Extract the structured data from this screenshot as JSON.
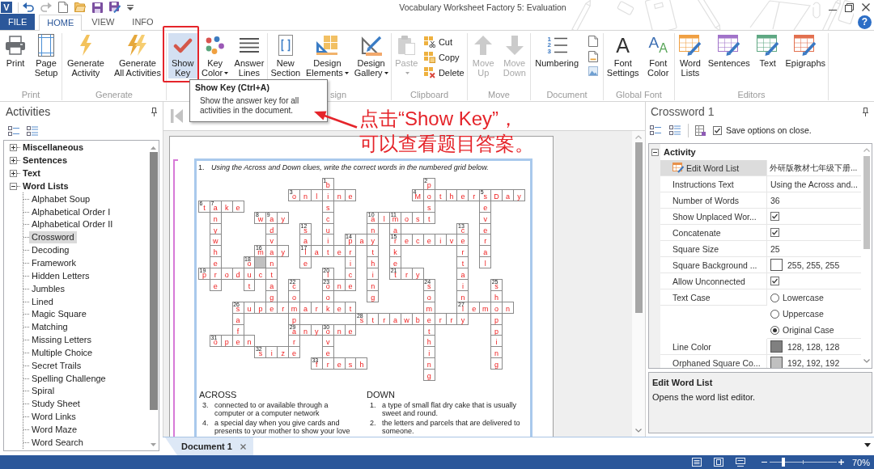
{
  "window": {
    "logo": "V",
    "title": "Vocabulary Worksheet Factory 5: Evaluation",
    "help": "?"
  },
  "ribbon": {
    "tabs": [
      {
        "label": "FILE",
        "kind": "backstage",
        "selected": false
      },
      {
        "label": "HOME",
        "kind": "tab",
        "selected": true
      },
      {
        "label": "VIEW",
        "kind": "tab",
        "selected": false
      },
      {
        "label": "INFO",
        "kind": "tab",
        "selected": false
      }
    ],
    "groups": [
      {
        "label": "Print",
        "buttons": [
          {
            "kind": "large",
            "label": "Print",
            "on": false,
            "disabled": false,
            "dropdown": false
          },
          {
            "kind": "large",
            "label": "Page Setup",
            "on": false,
            "disabled": false,
            "dropdown": false
          }
        ]
      },
      {
        "label": "Generate",
        "buttons": [
          {
            "kind": "large",
            "label": "Generate Activity",
            "on": false,
            "disabled": false,
            "dropdown": false
          },
          {
            "kind": "large",
            "label": "Generate All Activities",
            "on": false,
            "disabled": false,
            "dropdown": false
          }
        ]
      },
      {
        "buttons": [
          {
            "kind": "large",
            "label": "Show Key",
            "on": true,
            "disabled": false,
            "dropdown": false
          },
          {
            "kind": "large",
            "label": "Key Color",
            "on": false,
            "disabled": false,
            "dropdown": true
          },
          {
            "kind": "large",
            "label": "Answer Lines",
            "on": false,
            "disabled": false,
            "dropdown": false
          }
        ]
      },
      {
        "label": "sign",
        "buttons": [
          {
            "kind": "large",
            "label": "New Section",
            "on": false,
            "disabled": false,
            "dropdown": false
          },
          {
            "kind": "large",
            "label": "Design Elements",
            "on": false,
            "disabled": false,
            "dropdown": true
          },
          {
            "kind": "large",
            "label": "Design Gallery",
            "on": false,
            "disabled": false,
            "dropdown": true
          }
        ]
      },
      {
        "label": "Clipboard",
        "buttons": [
          {
            "kind": "large",
            "label": "Paste",
            "on": false,
            "disabled": true,
            "dropdown": true
          },
          {
            "kind": "small",
            "label": "Cut",
            "on": false,
            "disabled": false,
            "dropdown": false
          },
          {
            "kind": "small",
            "label": "Copy",
            "on": false,
            "disabled": false,
            "dropdown": false
          },
          {
            "kind": "small",
            "label": "Delete",
            "on": false,
            "disabled": false,
            "dropdown": false
          }
        ]
      },
      {
        "label": "Move",
        "buttons": [
          {
            "kind": "large",
            "label": "Move Up",
            "on": false,
            "disabled": true,
            "dropdown": false
          },
          {
            "kind": "large",
            "label": "Move Down",
            "on": false,
            "disabled": true,
            "dropdown": false
          }
        ]
      },
      {
        "label": "Document",
        "buttons": [
          {
            "kind": "large",
            "label": "Numbering",
            "glyph": "123",
            "on": false,
            "disabled": false,
            "dropdown": false
          },
          {
            "kind": "icon",
            "on": false,
            "disabled": false,
            "dropdown": false
          },
          {
            "kind": "icon",
            "on": false,
            "disabled": false,
            "dropdown": false
          },
          {
            "kind": "icon",
            "on": false,
            "disabled": false,
            "dropdown": false
          }
        ]
      },
      {
        "label": "Global Font",
        "buttons": [
          {
            "kind": "large",
            "label": "Font Settings",
            "glyph": "A",
            "on": false,
            "disabled": false,
            "dropdown": false
          },
          {
            "kind": "large",
            "label": "Font Color",
            "glyph": "AA",
            "on": false,
            "disabled": false,
            "dropdown": false
          }
        ]
      },
      {
        "label": "Editors",
        "buttons": [
          {
            "kind": "large",
            "label": "Word Lists",
            "on": false,
            "disabled": false,
            "dropdown": false
          },
          {
            "kind": "large",
            "label": "Sentences",
            "on": false,
            "disabled": false,
            "dropdown": false
          },
          {
            "kind": "large",
            "label": "Text",
            "on": false,
            "disabled": false,
            "dropdown": false
          },
          {
            "kind": "large",
            "label": "Epigraphs",
            "on": false,
            "disabled": false,
            "dropdown": false
          }
        ]
      }
    ]
  },
  "tooltip": {
    "title": "Show Key (Ctrl+A)",
    "text": "Show the answer key for all activities in the document."
  },
  "annotation": {
    "lines": [
      "点击“Show Key”，",
      "可以查看题目答案。"
    ]
  },
  "activities": {
    "title": "Activities",
    "tree": [
      {
        "label": "Miscellaneous",
        "expanded": false,
        "selected": false
      },
      {
        "label": "Sentences",
        "expanded": false,
        "selected": false
      },
      {
        "label": "Text",
        "expanded": false,
        "selected": false
      },
      {
        "label": "Word Lists",
        "expanded": true,
        "selected": false,
        "children": [
          {
            "label": "Alphabet Soup",
            "selected": false
          },
          {
            "label": "Alphabetical Order I",
            "selected": false
          },
          {
            "label": "Alphabetical Order II",
            "selected": false
          },
          {
            "label": "Crossword",
            "selected": true
          },
          {
            "label": "Decoding",
            "selected": false
          },
          {
            "label": "Framework",
            "selected": false
          },
          {
            "label": "Hidden Letters",
            "selected": false
          },
          {
            "label": "Jumbles",
            "selected": false
          },
          {
            "label": "Lined",
            "selected": false
          },
          {
            "label": "Magic Square",
            "selected": false
          },
          {
            "label": "Matching",
            "selected": false
          },
          {
            "label": "Missing Letters",
            "selected": false
          },
          {
            "label": "Multiple Choice",
            "selected": false
          },
          {
            "label": "Secret Trails",
            "selected": false
          },
          {
            "label": "Spelling Challenge",
            "selected": false
          },
          {
            "label": "Spiral",
            "selected": false
          },
          {
            "label": "Study Sheet",
            "selected": false
          },
          {
            "label": "Word Links",
            "selected": false
          },
          {
            "label": "Word Maze",
            "selected": false
          },
          {
            "label": "Word Search",
            "selected": false
          }
        ]
      }
    ]
  },
  "document": {
    "activity": {
      "number": "1.",
      "instructions": "Using the Across and Down clues, write the correct words in the numbered grid below.",
      "squares": [
        [
          {
            "letter": "b",
            "number": "1"
          },
          {
            "letter": "p",
            "number": "2"
          }
        ],
        [
          {
            "letter": "o",
            "number": "3"
          },
          {
            "letter": "n"
          },
          {
            "letter": "l"
          },
          {
            "letter": "i"
          },
          {
            "letter": "n"
          },
          {
            "letter": "e"
          },
          {
            "letter": "M",
            "number": "4"
          },
          {
            "letter": "o"
          },
          {
            "letter": "t"
          },
          {
            "letter": "h"
          },
          {
            "letter": "e"
          },
          {
            "letter": "r"
          },
          {
            "letter": "s",
            "number": "5"
          },
          {
            "letter": "D"
          },
          {
            "letter": "a"
          },
          {
            "letter": "y"
          }
        ],
        [
          {
            "letter": "t",
            "number": "6"
          },
          {
            "letter": "a",
            "number": "7"
          },
          {
            "letter": "k"
          },
          {
            "letter": "e"
          },
          {
            "letter": "s"
          },
          {
            "letter": "s"
          },
          {
            "letter": "e"
          }
        ],
        [
          {
            "letter": "n"
          },
          {
            "letter": "w",
            "number": "8"
          },
          {
            "letter": "a",
            "number": "9"
          },
          {
            "letter": "y"
          },
          {
            "letter": "c"
          },
          {
            "letter": "a",
            "number": "10"
          },
          {
            "letter": "l"
          },
          {
            "letter": "m",
            "number": "11"
          },
          {
            "letter": "o"
          },
          {
            "letter": "s"
          },
          {
            "letter": "t"
          },
          {
            "letter": "v"
          }
        ],
        [
          {
            "letter": "y"
          },
          {
            "letter": "d"
          },
          {
            "letter": "s",
            "number": "12"
          },
          {
            "letter": "u"
          },
          {
            "letter": "n"
          },
          {
            "letter": "a"
          },
          {
            "letter": "c",
            "number": "13"
          },
          {
            "letter": "e"
          }
        ],
        [
          {
            "letter": "w"
          },
          {
            "letter": "v"
          },
          {
            "letter": "a"
          },
          {
            "letter": "i"
          },
          {
            "letter": "p",
            "number": "14"
          },
          {
            "letter": "a"
          },
          {
            "letter": "y"
          },
          {
            "letter": "r",
            "number": "15"
          },
          {
            "letter": "e"
          },
          {
            "letter": "c"
          },
          {
            "letter": "e"
          },
          {
            "letter": "i"
          },
          {
            "letter": "v"
          },
          {
            "letter": "e"
          },
          {
            "letter": "r"
          }
        ],
        [
          {
            "letter": "h"
          },
          {
            "letter": "m",
            "number": "16"
          },
          {
            "letter": "a"
          },
          {
            "letter": "y"
          },
          {
            "letter": "l",
            "number": "17"
          },
          {
            "letter": "a"
          },
          {
            "letter": "t"
          },
          {
            "letter": "e"
          },
          {
            "letter": "r"
          },
          {
            "letter": "t"
          },
          {
            "letter": "k"
          },
          {
            "letter": "r"
          },
          {
            "letter": "a"
          }
        ],
        [
          {
            "letter": "e"
          },
          {
            "letter": "o",
            "number": "18"
          },
          {
            "orphaned": true
          },
          {
            "letter": "n"
          },
          {
            "letter": "e"
          },
          {
            "letter": "i"
          },
          {
            "letter": "h"
          },
          {
            "letter": "e"
          },
          {
            "letter": "t"
          },
          {
            "letter": "l"
          }
        ],
        [
          {
            "letter": "p",
            "number": "19"
          },
          {
            "letter": "r"
          },
          {
            "letter": "o"
          },
          {
            "letter": "d"
          },
          {
            "letter": "u"
          },
          {
            "letter": "c"
          },
          {
            "letter": "t"
          },
          {
            "letter": "l",
            "number": "20"
          },
          {
            "letter": "c"
          },
          {
            "letter": "i"
          },
          {
            "letter": "t",
            "number": "21"
          },
          {
            "letter": "r"
          },
          {
            "letter": "y"
          },
          {
            "letter": "a"
          }
        ],
        [
          {
            "letter": "e"
          },
          {
            "letter": "t"
          },
          {
            "letter": "a"
          },
          {
            "letter": "c",
            "number": "22"
          },
          {
            "letter": "o",
            "number": "23"
          },
          {
            "letter": "n"
          },
          {
            "letter": "e"
          },
          {
            "letter": "n"
          },
          {
            "letter": "s",
            "number": "24"
          },
          {
            "letter": "i"
          },
          {
            "letter": "s",
            "number": "25"
          }
        ],
        [
          {
            "letter": "g"
          },
          {
            "letter": "o"
          },
          {
            "letter": "o"
          },
          {
            "letter": "g"
          },
          {
            "letter": "o"
          },
          {
            "letter": "n"
          },
          {
            "letter": "h"
          }
        ],
        [
          {
            "letter": "s",
            "number": "26"
          },
          {
            "letter": "u"
          },
          {
            "letter": "p"
          },
          {
            "letter": "e"
          },
          {
            "letter": "r"
          },
          {
            "letter": "m"
          },
          {
            "letter": "a"
          },
          {
            "letter": "r"
          },
          {
            "letter": "k"
          },
          {
            "letter": "e"
          },
          {
            "letter": "t"
          },
          {
            "letter": "m"
          },
          {
            "letter": "l",
            "number": "27"
          },
          {
            "letter": "e"
          },
          {
            "letter": "m"
          },
          {
            "letter": "o"
          },
          {
            "letter": "n"
          }
        ],
        [
          {
            "letter": "a"
          },
          {
            "letter": "p"
          },
          {
            "letter": "s",
            "number": "28"
          },
          {
            "letter": "t"
          },
          {
            "letter": "r"
          },
          {
            "letter": "a"
          },
          {
            "letter": "w"
          },
          {
            "letter": "b"
          },
          {
            "letter": "e"
          },
          {
            "letter": "r"
          },
          {
            "letter": "r"
          },
          {
            "letter": "y"
          },
          {
            "letter": "p"
          }
        ],
        [
          {
            "letter": "f"
          },
          {
            "letter": "a",
            "number": "29"
          },
          {
            "letter": "n"
          },
          {
            "letter": "y"
          },
          {
            "letter": "o",
            "number": "30"
          },
          {
            "letter": "n"
          },
          {
            "letter": "e"
          },
          {
            "letter": "t"
          },
          {
            "letter": "p"
          }
        ],
        [
          {
            "letter": "o",
            "number": "31"
          },
          {
            "letter": "p"
          },
          {
            "letter": "e"
          },
          {
            "letter": "n"
          },
          {
            "letter": "r"
          },
          {
            "letter": "v"
          },
          {
            "letter": "h"
          },
          {
            "letter": "i"
          }
        ],
        [
          {
            "letter": "s",
            "number": "32"
          },
          {
            "letter": "i"
          },
          {
            "letter": "z"
          },
          {
            "letter": "e"
          },
          {
            "letter": "e"
          },
          {
            "letter": "i"
          },
          {
            "letter": "n"
          }
        ],
        [
          {
            "letter": "f",
            "number": "33"
          },
          {
            "letter": "r"
          },
          {
            "letter": "e"
          },
          {
            "letter": "s"
          },
          {
            "letter": "h"
          },
          {
            "letter": "n"
          },
          {
            "letter": "g"
          }
        ],
        [
          {
            "letter": "g"
          }
        ]
      ],
      "clues": [
        {
          "heading": "ACROSS",
          "items": [
            {
              "number": "3.",
              "text": "connected to or available through a computer or a computer network"
            },
            {
              "number": "4.",
              "text": "a special day when you give cards and presents to your mother to show your love"
            }
          ]
        },
        {
          "heading": "DOWN",
          "items": [
            {
              "number": "1.",
              "text": "a type of small flat dry cake that is usually sweet and round."
            },
            {
              "number": "2.",
              "text": "the letters and parcels that are delivered to someone."
            }
          ]
        }
      ]
    },
    "tabs": [
      {
        "label": "Document 1",
        "selected": true
      }
    ]
  },
  "properties": {
    "title": "Crossword 1",
    "save_options": {
      "label": "Save options on close.",
      "checked": true
    },
    "sections": [
      {
        "label": "Activity",
        "expanded": true,
        "rows": [
          {
            "label": "Edit Word List",
            "kind": "editor",
            "value": "外研版教材七年级下册...",
            "selected": true
          },
          {
            "label": "Instructions Text",
            "kind": "text",
            "value": "Using the Across and...",
            "selected": false
          },
          {
            "label": "Number of Words",
            "kind": "text",
            "value": "36",
            "selected": false
          },
          {
            "label": "Show Unplaced Wor...",
            "kind": "checkbox",
            "checked": true,
            "selected": false
          },
          {
            "label": "Concatenate",
            "kind": "checkbox",
            "checked": true,
            "selected": false
          },
          {
            "label": "Square Size",
            "kind": "text",
            "value": "25",
            "selected": false
          },
          {
            "label": "Square Background ...",
            "kind": "color",
            "color": "#ffffff",
            "value": "255, 255, 255",
            "selected": false
          },
          {
            "label": "Allow Unconnected",
            "kind": "checkbox",
            "checked": true,
            "selected": false
          },
          {
            "label": "Text Case",
            "kind": "radio",
            "selected": false,
            "options": [
              {
                "label": "Lowercase",
                "selected": false
              },
              {
                "label": "Uppercase",
                "selected": false
              },
              {
                "label": "Original Case",
                "selected": true
              }
            ]
          },
          {
            "label": "Line Color",
            "kind": "color",
            "color": "#808080",
            "value": "128, 128, 128",
            "selected": false
          },
          {
            "label": "Orphaned Square Co...",
            "kind": "color",
            "color": "#c0c0c0",
            "value": "192, 192, 192",
            "selected": false
          }
        ]
      }
    ],
    "description": {
      "title": "Edit Word List",
      "text": "Opens the word list editor."
    }
  },
  "status_bar": {
    "zoom": {
      "level": 0.2,
      "reading": "70%"
    }
  }
}
